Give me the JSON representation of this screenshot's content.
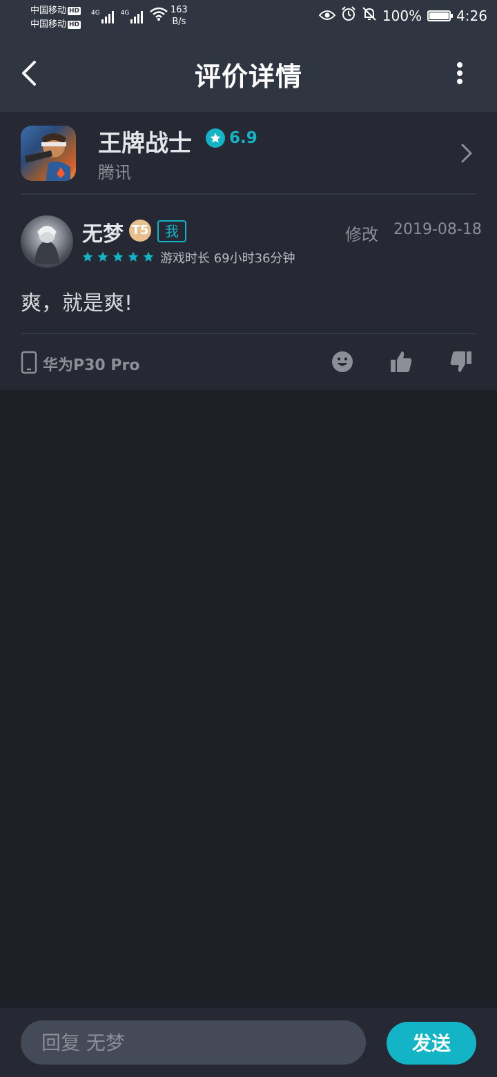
{
  "status_bar": {
    "carrier_1": "中国移动",
    "carrier_2": "中国移动",
    "hd_label": "HD",
    "net_type_1": "4G",
    "net_type_2": "4G",
    "net_speed_value": "163",
    "net_speed_unit": "B/s",
    "battery_level_percent": 100,
    "battery_text": "100%",
    "time": "4:26",
    "icons": [
      "eye-icon",
      "alarm-icon",
      "bell-off-icon",
      "wifi-icon",
      "signal-icon",
      "battery-icon"
    ]
  },
  "header": {
    "title": "评价详情",
    "back_icon": "back-arrow-icon",
    "more_icon": "more-vertical-icon"
  },
  "game": {
    "name": "王牌战士",
    "rating": "6.9",
    "publisher": "腾讯",
    "rating_icon": "star-badge-icon",
    "arrow_icon": "chevron-right-icon"
  },
  "review": {
    "username": "无梦",
    "level_badge": "T5",
    "me_tag": "我",
    "edit_label": "修改",
    "date": "2019-08-18",
    "star_rating": 5,
    "star_max": 5,
    "playtime": "游戏时长 69小时36分钟",
    "text": "爽，就是爽!",
    "device": "华为P30 Pro"
  },
  "actions": {
    "icons": [
      "emoji-icon",
      "thumbs-up-icon",
      "thumbs-down-icon"
    ]
  },
  "reply": {
    "placeholder": "回复 无梦",
    "value": "",
    "send_label": "发送"
  },
  "colors": {
    "accent": "#14b4c7",
    "header_bg": "#303542",
    "card_bg": "#262833",
    "page_bg": "#1f1f28",
    "level_badge": "#e9c08d"
  }
}
